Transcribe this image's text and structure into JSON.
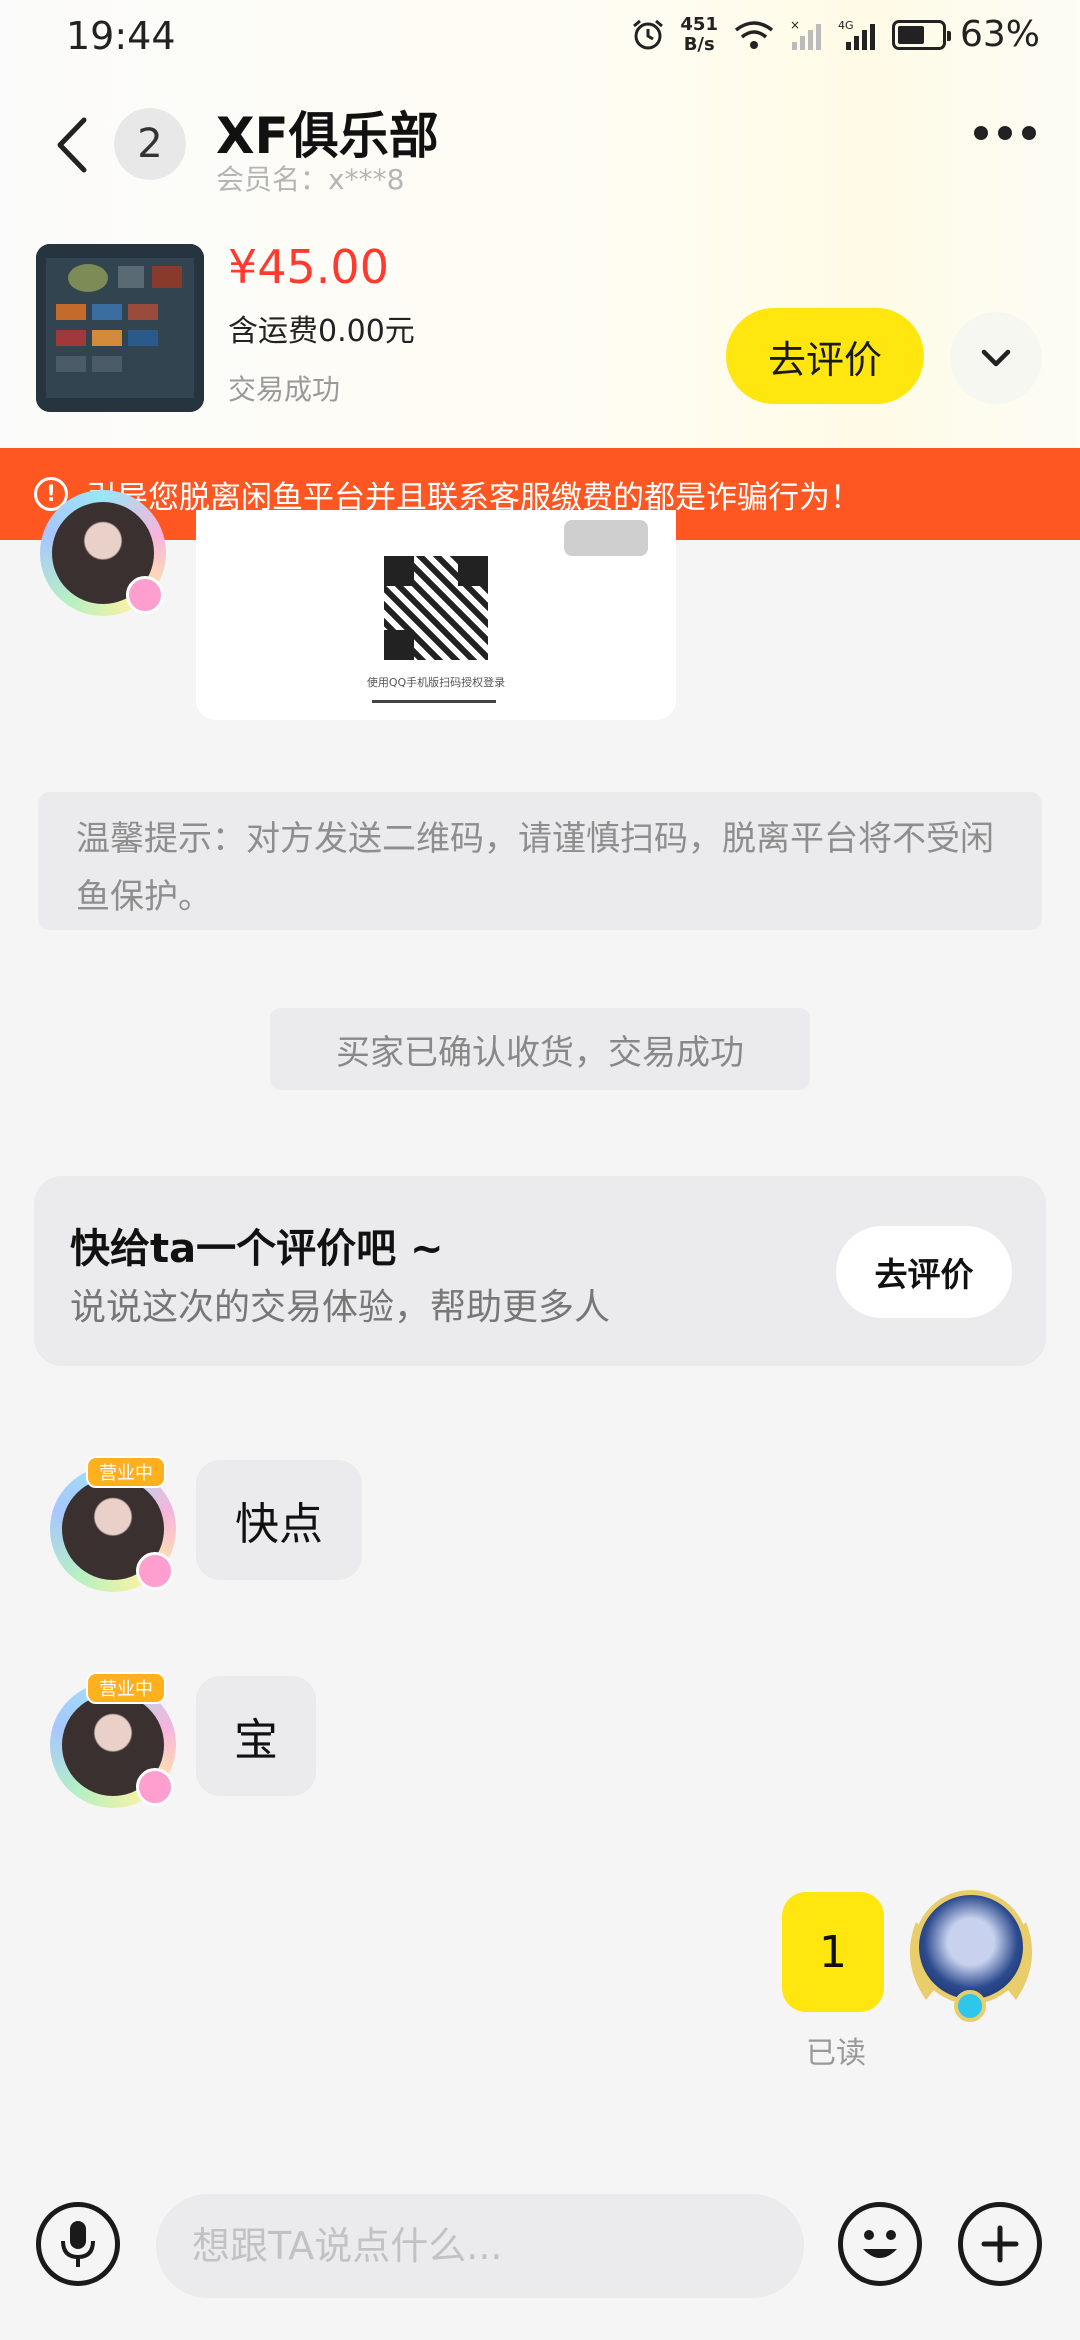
{
  "status_bar": {
    "time": "19:44",
    "net_rate_top": "451",
    "net_rate_bottom": "B/s",
    "signal": "4G",
    "battery": "63%"
  },
  "header": {
    "unread_count": "2",
    "title": "XF俱乐部",
    "member_name": "会员名：x***8"
  },
  "order": {
    "price": "¥45.00",
    "shipping": "含运费0.00元",
    "status": "交易成功",
    "review_button": "去评价"
  },
  "warning": {
    "text": "引导您脱离闲鱼平台并且联系客服缴费的都是诈骗行为！"
  },
  "chat": {
    "qr_caption": "使用QQ手机版扫码授权登录",
    "tip": "温馨提示：对方发送二维码，请谨慎扫码，脱离平台将不受闲鱼保护。",
    "system_message": "买家已确认收货，交易成功",
    "rate_card": {
      "title": "快给ta一个评价吧 ~",
      "subtitle": "说说这次的交易体验，帮助更多人",
      "button": "去评价"
    },
    "avatar_badge": "营业中",
    "messages": [
      {
        "from": "other",
        "text": "快点"
      },
      {
        "from": "other",
        "text": "宝"
      },
      {
        "from": "me",
        "text": "1",
        "status": "已读"
      }
    ]
  },
  "input": {
    "placeholder": "想跟TA说点什么..."
  },
  "colors": {
    "accent_yellow": "#ffe60f",
    "warning_orange": "#ff5722",
    "price_red": "#ff3b30"
  }
}
